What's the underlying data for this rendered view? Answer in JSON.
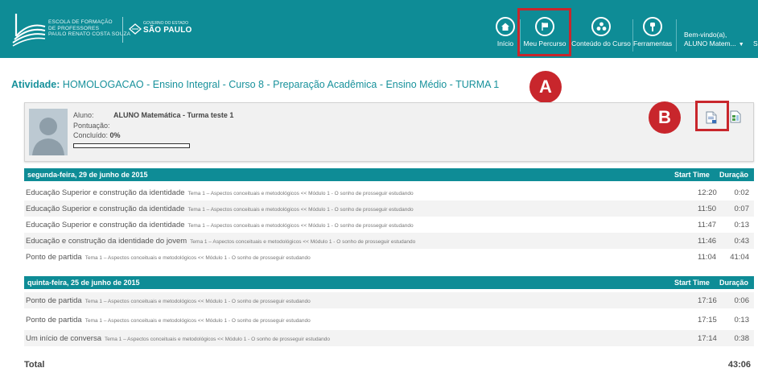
{
  "header": {
    "school_lines": [
      "ESCOLA DE FORMAÇÃO",
      "DE PROFESSORES",
      "PAULO RENATO COSTA SOUZA"
    ],
    "gov_small": "GOVERNO DO ESTADO",
    "gov_big": "SÃO PAULO",
    "nav": [
      {
        "label": "Início",
        "icon": "home-icon"
      },
      {
        "label": "Meu Percurso",
        "icon": "flag-icon"
      },
      {
        "label": "Conteúdo do Curso",
        "icon": "content-icon"
      },
      {
        "label": "Ferramentas",
        "icon": "tools-icon"
      }
    ],
    "welcome_line1": "Bem-vindo(a),",
    "welcome_user": "ALUNO Matem...",
    "welcome_extra": "Sa"
  },
  "annotations": {
    "a": "A",
    "b": "B"
  },
  "activity": {
    "label": "Atividade:",
    "title": "HOMOLOGACAO - Ensino Integral - Curso 8 - Preparação Acadêmica - Ensino Médio - TURMA 1"
  },
  "student": {
    "aluno_label": "Aluno:",
    "aluno_value": "ALUNO Matemática - Turma teste 1",
    "pontuacao_label": "Pontuação:",
    "concluido_label": "Concluído:",
    "concluido_value": "0%",
    "progress": 0
  },
  "columns": {
    "start_time": "Start Time",
    "duracao": "Duração"
  },
  "groups": [
    {
      "date": "segunda-feira, 29 de junho de 2015",
      "rows": [
        {
          "title": "Educação Superior e construção da identidade",
          "sub": "Tema 1 – Aspectos conceituais e metodológicos << Módulo 1 - O sonho de prosseguir estudando",
          "time": "12:20",
          "dur": "0:02"
        },
        {
          "title": "Educação Superior e construção da identidade",
          "sub": "Tema 1 – Aspectos conceituais e metodológicos << Módulo 1 - O sonho de prosseguir estudando",
          "time": "11:50",
          "dur": "0:07"
        },
        {
          "title": "Educação Superior e construção da identidade",
          "sub": "Tema 1 – Aspectos conceituais e metodológicos << Módulo 1 - O sonho de prosseguir estudando",
          "time": "11:47",
          "dur": "0:13"
        },
        {
          "title": "Educação e construção da identidade do jovem",
          "sub": "Tema 1 – Aspectos conceituais e metodológicos << Módulo 1 - O sonho de prosseguir estudando",
          "time": "11:46",
          "dur": "0:43"
        },
        {
          "title": "Ponto de partida",
          "sub": "Tema 1 – Aspectos conceituais e metodológicos << Módulo 1 - O sonho de prosseguir estudando",
          "time": "11:04",
          "dur": "41:04"
        }
      ]
    },
    {
      "date": "quinta-feira, 25 de junho de 2015",
      "rows": [
        {
          "title": "Ponto de partida",
          "sub": "Tema 1 – Aspectos conceituais e metodológicos << Módulo 1 - O sonho de prosseguir estudando",
          "time": "17:16",
          "dur": "0:06"
        },
        {
          "title": "Ponto de partida",
          "sub": "Tema 1 – Aspectos conceituais e metodológicos << Módulo 1 - O sonho de prosseguir estudando",
          "time": "17:15",
          "dur": "0:13"
        },
        {
          "title": "Um início de conversa",
          "sub": "Tema 1 – Aspectos conceituais e metodológicos << Módulo 1 - O sonho de prosseguir estudando",
          "time": "17:14",
          "dur": "0:38"
        }
      ]
    }
  ],
  "total": {
    "label": "Total",
    "value": "43:06"
  },
  "colors": {
    "teal": "#0e8c96",
    "red": "#c8262c"
  }
}
